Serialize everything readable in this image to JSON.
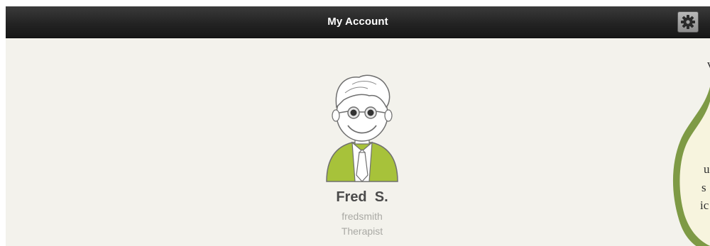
{
  "nav_bar": {
    "title": "My Account",
    "settings_icon": "gear-icon"
  },
  "profile": {
    "avatar_icon": "therapist-avatar",
    "name": "Fred  S.",
    "username": "fredsmith",
    "role": "Therapist"
  },
  "tooltip": {
    "fragments": [
      "v",
      "u",
      "s",
      "ic"
    ]
  },
  "colors": {
    "nav_bar": "#232323",
    "background": "#f3f2ec",
    "avatar_shirt": "#a7c23a",
    "tooltip_border": "#7e9a45",
    "tooltip_fill": "#f7f4de"
  }
}
